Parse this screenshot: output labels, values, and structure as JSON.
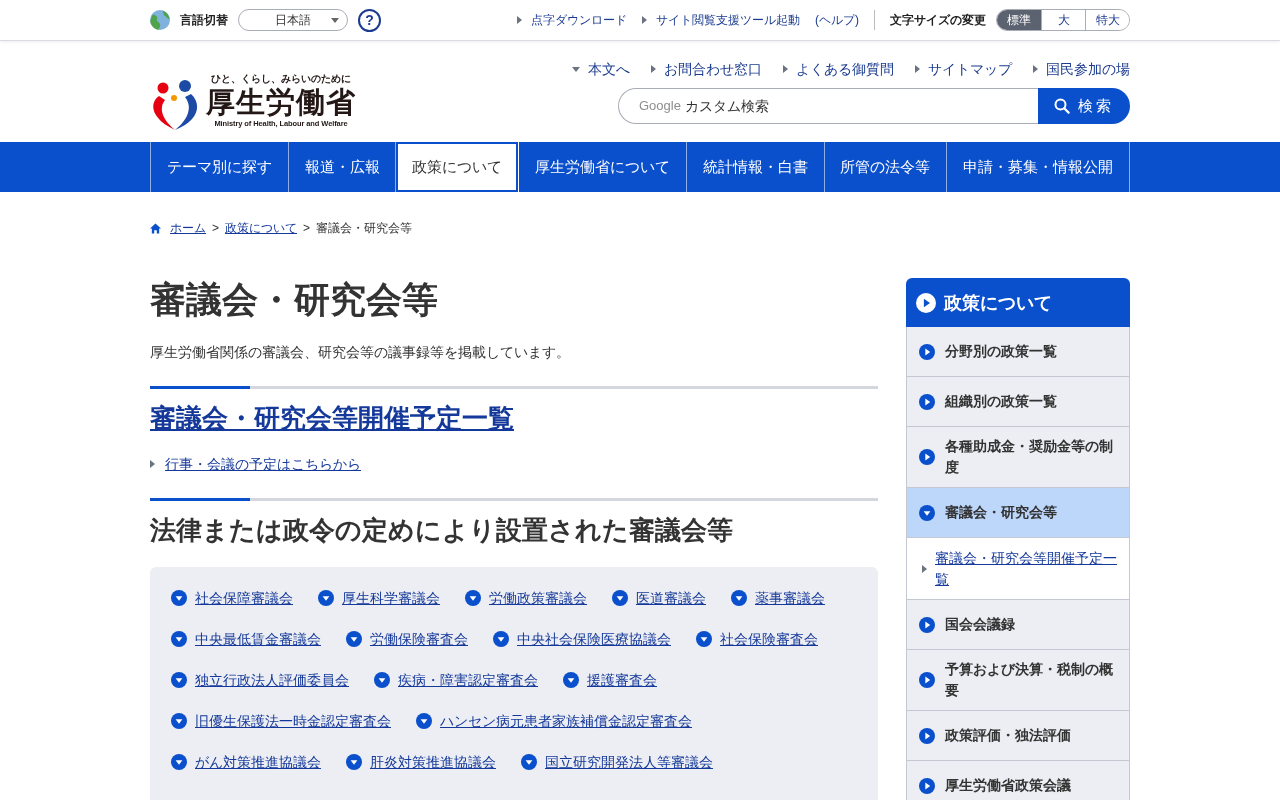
{
  "top_bar": {
    "language_label": "言語切替",
    "language_select": {
      "value": "日本語"
    },
    "help": "?",
    "links": [
      {
        "label": "点字ダウンロード"
      },
      {
        "label": "サイト閲覧支援ツール起動"
      }
    ],
    "help_link": "(ヘルプ)",
    "font_size_label": "文字サイズの変更",
    "font_sizes": [
      {
        "label": "標準",
        "selected": true
      },
      {
        "label": "大",
        "selected": false
      },
      {
        "label": "特大",
        "selected": false
      }
    ]
  },
  "logo": {
    "tagline": "ひと、くらし、みらいのために",
    "name": "厚生労働省",
    "english": "Ministry of Health, Labour and Welfare"
  },
  "header_links": [
    {
      "label": "本文へ",
      "kind": "jump"
    },
    {
      "label": "お問合わせ窓口",
      "kind": "page"
    },
    {
      "label": "よくある御質問",
      "kind": "page"
    },
    {
      "label": "サイトマップ",
      "kind": "page"
    },
    {
      "label": "国民参加の場",
      "kind": "page"
    }
  ],
  "search": {
    "brand": "Google",
    "placeholder": "カスタム検索",
    "button": "検索"
  },
  "nav": [
    {
      "label": "テーマ別に探す",
      "selected": false
    },
    {
      "label": "報道・広報",
      "selected": false
    },
    {
      "label": "政策について",
      "selected": true
    },
    {
      "label": "厚生労働省について",
      "selected": false
    },
    {
      "label": "統計情報・白書",
      "selected": false
    },
    {
      "label": "所管の法令等",
      "selected": false
    },
    {
      "label": "申請・募集・情報公開",
      "selected": false
    }
  ],
  "breadcrumb": [
    {
      "label": "ホーム",
      "kind": "home"
    },
    {
      "label": ">",
      "kind": "separator"
    },
    {
      "label": "政策について",
      "kind": "link"
    },
    {
      "label": ">",
      "kind": "separator"
    },
    {
      "label": "審議会・研究会等",
      "kind": "current"
    }
  ],
  "page": {
    "title": "審議会・研究会等",
    "lead": "厚生労働省関係の審議会、研究会等の議事録等を掲載しています。",
    "sections": [
      {
        "kind": "links",
        "heading": "審議会・研究会等開催予定一覧",
        "links": [
          "行事・会議の予定はこちらから"
        ]
      },
      {
        "kind": "grid",
        "heading": "法律または政令の定めにより設置された審議会等",
        "links": [
          "社会保障審議会",
          "厚生科学審議会",
          "労働政策審議会",
          "医道審議会",
          "薬事審議会",
          "中央最低賃金審議会",
          "労働保険審査会",
          "中央社会保険医療協議会",
          "社会保険審査会",
          "独立行政法人評価委員会",
          "疾病・障害認定審査会",
          "援護審査会",
          "旧優生保護法一時金認定審査会",
          "ハンセン病元患者家族補償金認定審査会",
          "がん対策推進協議会",
          "肝炎対策推進協議会",
          "国立研究開発法人等審議会"
        ]
      }
    ]
  },
  "sidebar": {
    "title": "政策について",
    "items": [
      {
        "label": "分野別の政策一覧",
        "selected": false,
        "expanded": false
      },
      {
        "label": "組織別の政策一覧",
        "selected": false,
        "expanded": false
      },
      {
        "label": "各種助成金・奨励金等の制度",
        "selected": false,
        "expanded": false
      },
      {
        "label": "審議会・研究会等",
        "selected": true,
        "expanded": true,
        "children": [
          {
            "label": "審議会・研究会等開催予定一覧"
          }
        ]
      },
      {
        "label": "国会会議録",
        "selected": false,
        "expanded": false
      },
      {
        "label": "予算および決算・税制の概要",
        "selected": false,
        "expanded": false
      },
      {
        "label": "政策評価・独法評価",
        "selected": false,
        "expanded": false
      },
      {
        "label": "厚生労働省政策会議",
        "selected": false,
        "expanded": false
      }
    ]
  }
}
